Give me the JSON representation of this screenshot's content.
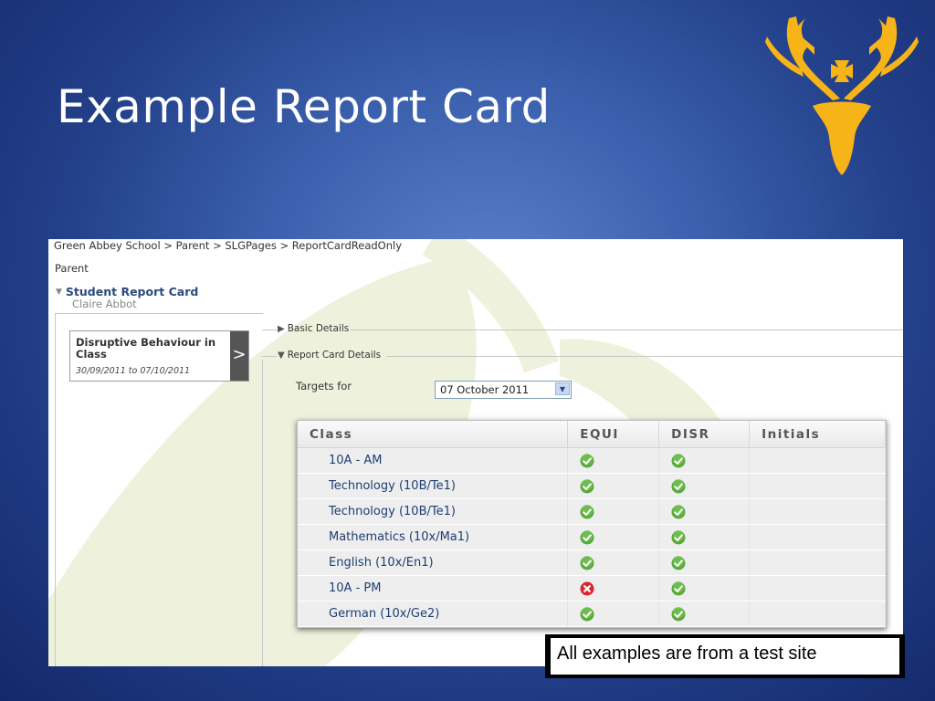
{
  "slide": {
    "title": "Example Report Card",
    "caption": "All examples are from a test site"
  },
  "page": {
    "breadcrumb": "Green Abbey School > Parent > SLGPages > ReportCardReadOnly",
    "section_label": "Parent",
    "card_title": "Student Report Card",
    "student_name": "Claire Abbot"
  },
  "behaviour_card": {
    "title": "Disruptive Behaviour in Class",
    "dates": "30/09/2011 to 07/10/2011"
  },
  "fieldsets": {
    "basic_details": "Basic Details",
    "report_card_details": "Report Card Details"
  },
  "targets": {
    "label": "Targets for",
    "selected": "07 October 2011"
  },
  "grid": {
    "columns": [
      "Class",
      "EQUI",
      "DISR",
      "Initials"
    ],
    "rows": [
      {
        "class": "10A - AM",
        "equi": "ok",
        "disr": "ok",
        "initials": ""
      },
      {
        "class": "Technology (10B/Te1)",
        "equi": "ok",
        "disr": "ok",
        "initials": ""
      },
      {
        "class": "Technology (10B/Te1)",
        "equi": "ok",
        "disr": "ok",
        "initials": ""
      },
      {
        "class": "Mathematics (10x/Ma1)",
        "equi": "ok",
        "disr": "ok",
        "initials": ""
      },
      {
        "class": "English (10x/En1)",
        "equi": "ok",
        "disr": "ok",
        "initials": ""
      },
      {
        "class": "10A - PM",
        "equi": "fail",
        "disr": "ok",
        "initials": ""
      },
      {
        "class": "German (10x/Ge2)",
        "equi": "ok",
        "disr": "ok",
        "initials": ""
      }
    ]
  },
  "icons": {
    "ok": "green-check-icon",
    "fail": "red-cross-icon",
    "logo": "stag-head-icon"
  },
  "colors": {
    "background": "#2b4a94",
    "logo": "#f7b418",
    "ok": "#5aaa3c",
    "fail": "#d8262e",
    "link": "#1d3e72"
  }
}
